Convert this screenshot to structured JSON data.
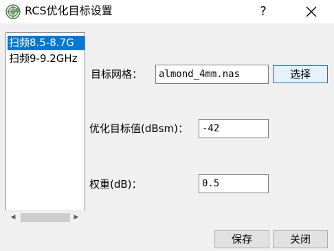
{
  "window": {
    "title": "RCS优化目标设置",
    "help": "?",
    "icon": "radar-app-icon"
  },
  "list": {
    "items": [
      {
        "label": "扫频8.5-8.7G",
        "selected": true
      },
      {
        "label": "扫频9-9.2GHz",
        "selected": false
      }
    ]
  },
  "form": {
    "mesh_label": "目标网格：",
    "mesh_value": "almond_4mm.nas",
    "choose_label": "选择",
    "target_label": "优化目标值(dBsm)：",
    "target_value": "-42",
    "weight_label": "权重(dB)：",
    "weight_value": "0.5"
  },
  "buttons": {
    "save": "保存",
    "close": "关闭"
  },
  "colors": {
    "selection": "#0078d7",
    "window_bg": "#f0f0f0"
  }
}
